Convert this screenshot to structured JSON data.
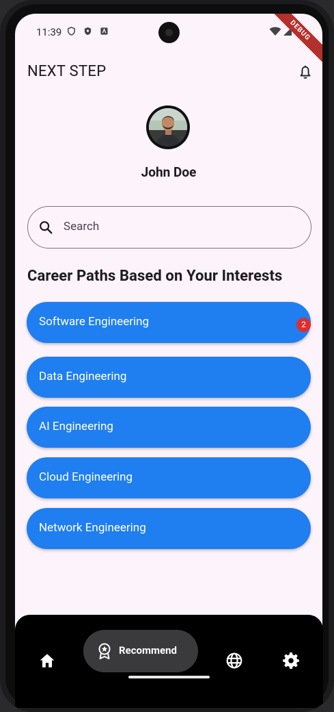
{
  "status_bar": {
    "time": "11:39"
  },
  "debug_banner": "DEBUG",
  "app": {
    "title": "NEXT STEP"
  },
  "profile": {
    "name": "John Doe"
  },
  "search": {
    "placeholder": "Search"
  },
  "section": {
    "title": "Career Paths Based on Your Interests"
  },
  "careers": [
    {
      "label": "Software Engineering",
      "badge": "2"
    },
    {
      "label": "Data Engineering"
    },
    {
      "label": "AI Engineering"
    },
    {
      "label": "Cloud Engineering"
    },
    {
      "label": "Network Engineering"
    }
  ],
  "bottom_nav": {
    "items": [
      {
        "icon": "home-icon"
      },
      {
        "icon": "recommend-icon",
        "label": "Recommend",
        "selected": true
      },
      {
        "icon": "globe-icon"
      },
      {
        "icon": "settings-icon"
      }
    ]
  },
  "colors": {
    "accent": "#1f7ef0",
    "background": "#fdf3fb",
    "badge": "#e12c2c",
    "nav_bg": "#000000",
    "nav_pill": "#3a3a3c"
  }
}
